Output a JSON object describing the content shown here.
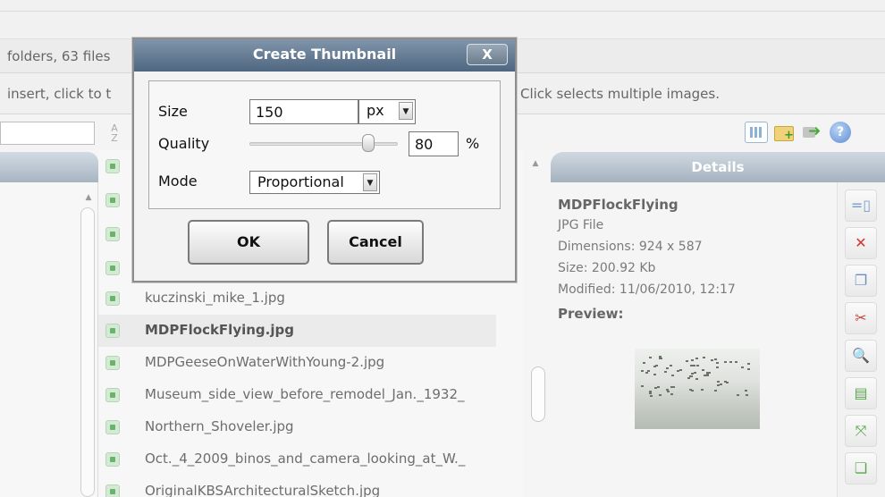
{
  "status": {
    "summary": "folders, 63 files"
  },
  "hints": {
    "left": "insert, click to t",
    "right": "Click selects multiple images."
  },
  "toolbar": {
    "sort_icon": "sort-icon",
    "icons": [
      "grid-view-icon",
      "new-folder-icon",
      "move-arrow-icon",
      "help-icon"
    ],
    "help_glyph": "?"
  },
  "dialog": {
    "title": "Create Thumbnail",
    "close_label": "X",
    "size_label": "Size",
    "size_value": "150",
    "unit_value": "px",
    "quality_label": "Quality",
    "quality_value": "80",
    "quality_fraction": 0.8,
    "quality_unit": "%",
    "mode_label": "Mode",
    "mode_value": "Proportional",
    "ok_label": "OK",
    "cancel_label": "Cancel"
  },
  "files": [
    {
      "name": "kuczinski_mike_1.jpg",
      "selected": false
    },
    {
      "name": "MDPFlockFlying.jpg",
      "selected": true
    },
    {
      "name": "MDPGeeseOnWaterWithYoung-2.jpg",
      "selected": false
    },
    {
      "name": "Museum_side_view_before_remodel_Jan._1932_",
      "selected": false
    },
    {
      "name": "Northern_Shoveler.jpg",
      "selected": false
    },
    {
      "name": "Oct._4_2009_binos_and_camera_looking_at_W._",
      "selected": false
    },
    {
      "name": "OriginalKBSArchitecturalSketch.jpg",
      "selected": false
    }
  ],
  "details": {
    "header": "Details",
    "name": "MDPFlockFlying",
    "type": "JPG File",
    "dimensions": "Dimensions: 924 x 587",
    "size": "Size: 200.92 Kb",
    "modified": "Modified: 11/06/2010, 12:17",
    "preview_label": "Preview:"
  },
  "actions": [
    {
      "icon": "resize-icon",
      "glyph": "=▯",
      "color": "#7a9ccc"
    },
    {
      "icon": "delete-icon",
      "glyph": "✕",
      "color": "#d9342b"
    },
    {
      "icon": "copy-icon",
      "glyph": "❐",
      "color": "#6a8fc4"
    },
    {
      "icon": "cut-icon",
      "glyph": "✂",
      "color": "#c2453a"
    },
    {
      "icon": "zoom-icon",
      "glyph": "🔍",
      "color": "#6a8fc4"
    },
    {
      "icon": "new-file-icon",
      "glyph": "▤",
      "color": "#5aa84a"
    },
    {
      "icon": "expand-icon",
      "glyph": "⤧",
      "color": "#5aa84a"
    },
    {
      "icon": "duplicate-icon",
      "glyph": "❏",
      "color": "#5aa84a"
    }
  ]
}
